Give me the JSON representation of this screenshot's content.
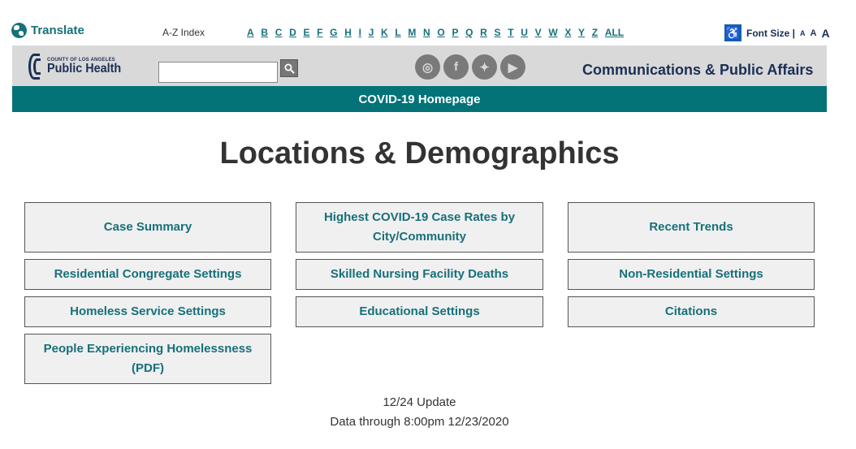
{
  "topbar": {
    "translate_label": "Translate",
    "az_label": "A-Z Index",
    "letters": [
      "A",
      "B",
      "C",
      "D",
      "E",
      "F",
      "G",
      "H",
      "I",
      "J",
      "K",
      "L",
      "M",
      "N",
      "O",
      "P",
      "Q",
      "R",
      "S",
      "T",
      "U",
      "V",
      "W",
      "X",
      "Y",
      "Z",
      "ALL"
    ],
    "font_size_label": "Font Size |",
    "font_size_small": "A",
    "font_size_medium": "A",
    "font_size_large": "A"
  },
  "header": {
    "logo_small": "COUNTY OF LOS ANGELES",
    "logo_big": "Public Health",
    "search_placeholder": "",
    "search_icon": "search-icon",
    "social": [
      {
        "name": "instagram-icon",
        "glyph": "◎"
      },
      {
        "name": "facebook-icon",
        "glyph": "f"
      },
      {
        "name": "twitter-icon",
        "glyph": "✦"
      },
      {
        "name": "youtube-icon",
        "glyph": "▶"
      }
    ],
    "department": "Communications & Public Affairs"
  },
  "nav": {
    "home_link": "COVID-19 Homepage"
  },
  "main": {
    "title": "Locations & Demographics",
    "tiles": [
      "Case Summary",
      "Highest COVID-19 Case Rates by City/Community",
      "Recent Trends",
      "Residential Congregate Settings",
      "Skilled Nursing Facility Deaths",
      "Non-Residential Settings",
      "Homeless Service Settings",
      "Educational Settings",
      "Citations",
      "People Experiencing Homelessness (PDF)"
    ],
    "update_line1": "12/24 Update",
    "update_line2": "Data through 8:00pm 12/23/2020"
  },
  "colors": {
    "teal": "#037378",
    "link_teal": "#17707a",
    "navy": "#1b2f55",
    "header_gray": "#d9d9d9",
    "tile_bg": "#f0f0f0"
  }
}
